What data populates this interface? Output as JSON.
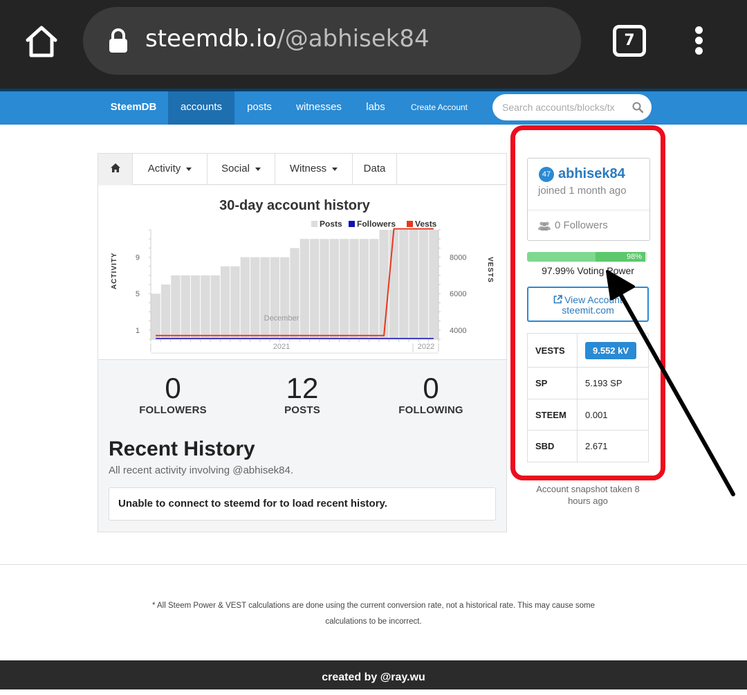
{
  "browser": {
    "url_domain": "steemdb.io",
    "url_path": "/@abhisek84",
    "tab_count": "7"
  },
  "navbar": {
    "brand": "SteemDB",
    "items": [
      "accounts",
      "posts",
      "witnesses",
      "labs",
      "Create Account"
    ],
    "search_placeholder": "Search accounts/blocks/tx"
  },
  "tabs": {
    "activity": "Activity",
    "social": "Social",
    "witness": "Witness",
    "data": "Data"
  },
  "chart_data": {
    "type": "bar",
    "title": "30-day account history",
    "legend": [
      "Posts",
      "Followers",
      "Vests"
    ],
    "legend_position": "top-right",
    "colors": {
      "Posts": "#dcdcdc",
      "Followers": "#1010b8",
      "Vests": "#e8381c"
    },
    "ylabel": "ACTIVITY",
    "y2label": "VESTS",
    "yticks": [
      "1",
      "5",
      "9"
    ],
    "y2ticks": [
      "4000",
      "6000",
      "8000"
    ],
    "ylim": [
      0,
      12
    ],
    "y2lim": [
      3500,
      9500
    ],
    "xlabel_month": "December",
    "xlabel_years": [
      "2021",
      "2022"
    ],
    "posts": [
      5,
      6,
      7,
      7,
      7,
      7,
      7,
      8,
      8,
      9,
      9,
      9,
      9,
      9,
      10,
      11,
      11,
      11,
      11,
      11,
      11,
      11,
      11,
      12,
      12,
      12,
      12,
      12,
      12
    ],
    "vests": [
      3700,
      3700,
      3700,
      3700,
      3700,
      3700,
      3700,
      3700,
      3700,
      3700,
      3700,
      3700,
      3700,
      3700,
      3700,
      3700,
      3700,
      3700,
      3700,
      3700,
      3700,
      3700,
      3700,
      3700,
      9552,
      9552,
      9552,
      9552,
      9552
    ],
    "followers": [
      0,
      0,
      0,
      0,
      0,
      0,
      0,
      0,
      0,
      0,
      0,
      0,
      0,
      0,
      0,
      0,
      0,
      0,
      0,
      0,
      0,
      0,
      0,
      0,
      0,
      0,
      0,
      0,
      0
    ]
  },
  "stats": {
    "followers": {
      "value": "0",
      "label": "FOLLOWERS"
    },
    "posts": {
      "value": "12",
      "label": "POSTS"
    },
    "following": {
      "value": "0",
      "label": "FOLLOWING"
    }
  },
  "recent_history": {
    "title": "Recent History",
    "subtitle": "All recent activity involving @abhisek84.",
    "message": "Unable to connect to steemd for to load recent history."
  },
  "profile": {
    "reputation": "47",
    "username": "abhisek84",
    "joined": "joined 1 month ago",
    "followers": "0 Followers",
    "voting_power_fraction": 0.9799,
    "voting_power_badge": "98%",
    "voting_power_label": "97.99% Voting Power",
    "view_account_line1": "View Account",
    "view_account_line2": "steemit.com"
  },
  "balances": [
    {
      "key": "VESTS",
      "value": "9.552 kV"
    },
    {
      "key": "SP",
      "value": "5.193 SP"
    },
    {
      "key": "STEEM",
      "value": "0.001"
    },
    {
      "key": "SBD",
      "value": "2.671"
    }
  ],
  "snapshot": "Account snapshot taken 8 hours ago",
  "footer": {
    "note": "* All Steem Power & VEST calculations are done using the current conversion rate, not a historical rate. This may cause some calculations to be incorrect.",
    "credit": "created by @ray.wu"
  },
  "colors": {
    "nav_blue": "#2a8ad4",
    "highlight_red": "#ec0d1d",
    "annotation_arrow": "#000000"
  }
}
